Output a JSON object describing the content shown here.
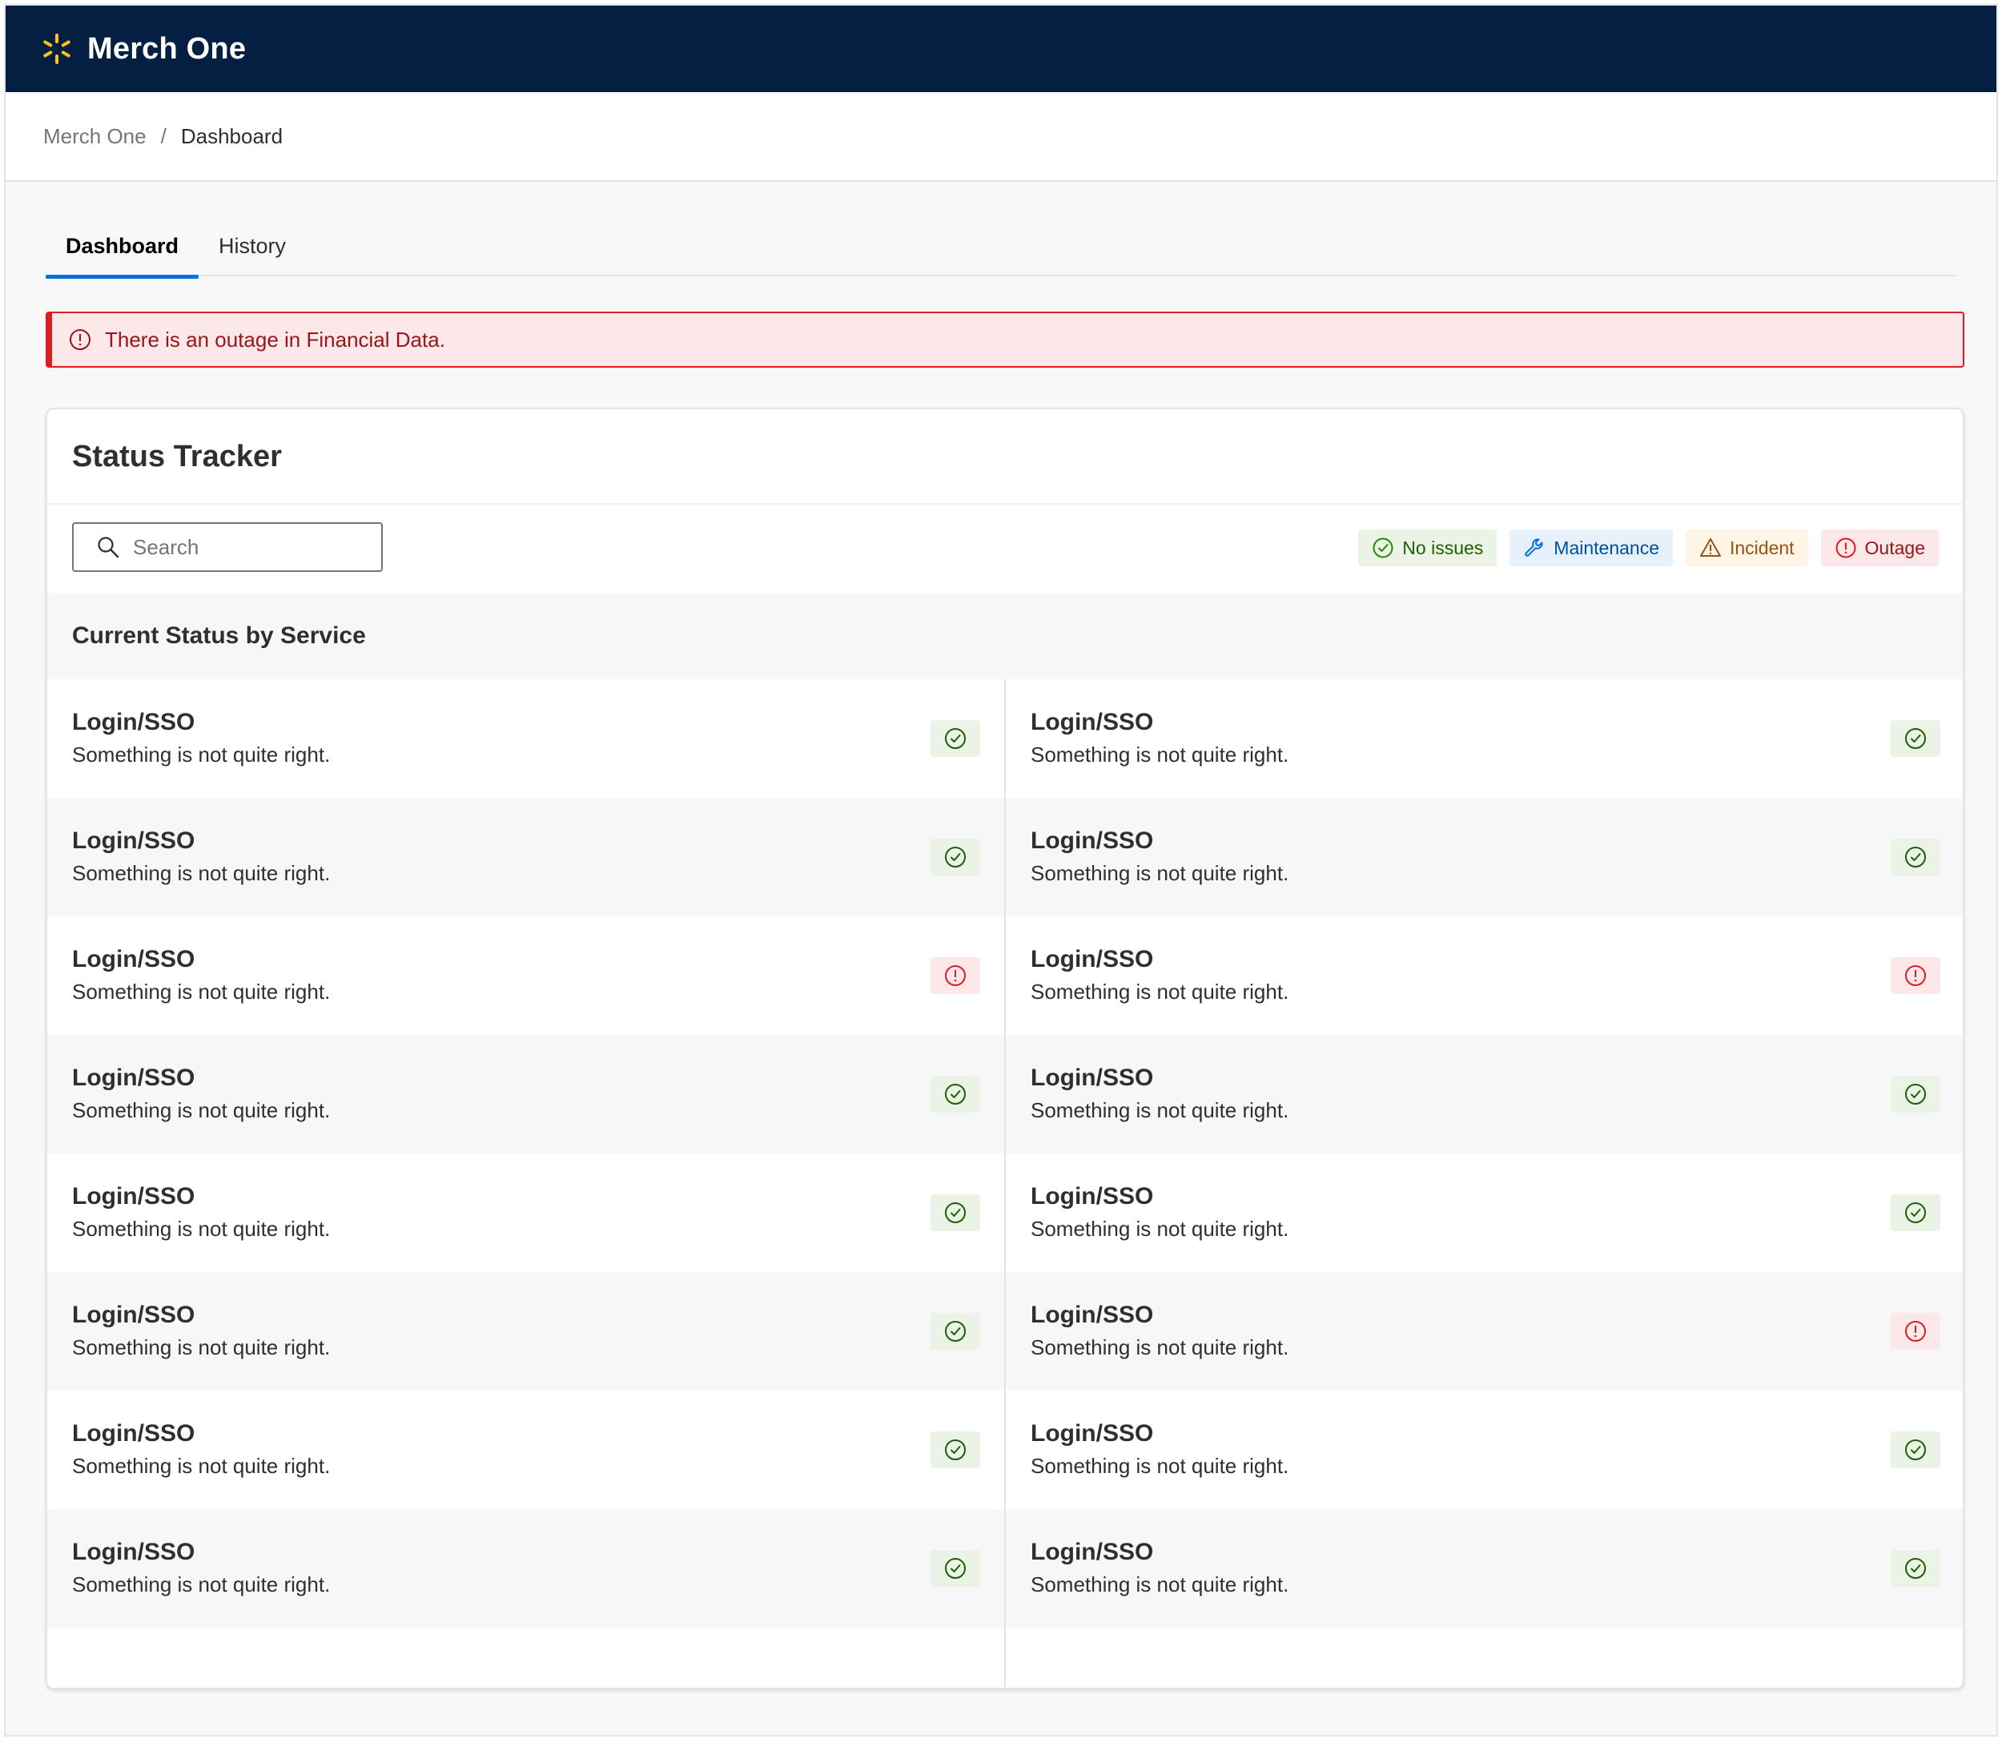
{
  "header": {
    "app_title": "Merch One",
    "logo_icon": "spark-icon",
    "bg_color": "#041f41",
    "logo_color": "#ffc220"
  },
  "breadcrumb": {
    "root": "Merch One",
    "separator": "/",
    "current": "Dashboard"
  },
  "tabs": [
    {
      "label": "Dashboard",
      "active": true
    },
    {
      "label": "History",
      "active": false
    }
  ],
  "alert": {
    "message": "There is an outage in Financial Data.",
    "icon": "alert-circle-icon",
    "color": "#de1c24"
  },
  "status_tracker": {
    "title": "Status Tracker",
    "search": {
      "placeholder": "Search",
      "value": ""
    },
    "legend": [
      {
        "label": "No issues",
        "icon": "check-circle-icon",
        "status": "ok"
      },
      {
        "label": "Maintenance",
        "icon": "wrench-icon",
        "status": "maintenance"
      },
      {
        "label": "Incident",
        "icon": "warning-triangle-icon",
        "status": "incident"
      },
      {
        "label": "Outage",
        "icon": "alert-circle-icon",
        "status": "outage"
      }
    ],
    "section_title": "Current Status by Service",
    "left_services": [
      {
        "name": "Login/SSO",
        "description": "Something is not quite right.",
        "status": "ok"
      },
      {
        "name": "Login/SSO",
        "description": "Something is not quite right.",
        "status": "ok"
      },
      {
        "name": "Login/SSO",
        "description": "Something is not quite right.",
        "status": "outage"
      },
      {
        "name": "Login/SSO",
        "description": "Something is not quite right.",
        "status": "ok"
      },
      {
        "name": "Login/SSO",
        "description": "Something is not quite right.",
        "status": "ok"
      },
      {
        "name": "Login/SSO",
        "description": "Something is not quite right.",
        "status": "ok"
      },
      {
        "name": "Login/SSO",
        "description": "Something is not quite right.",
        "status": "ok"
      },
      {
        "name": "Login/SSO",
        "description": "Something is not quite right.",
        "status": "ok"
      }
    ],
    "right_services": [
      {
        "name": "Login/SSO",
        "description": "Something is not quite right.",
        "status": "ok"
      },
      {
        "name": "Login/SSO",
        "description": "Something is not quite right.",
        "status": "ok"
      },
      {
        "name": "Login/SSO",
        "description": "Something is not quite right.",
        "status": "outage"
      },
      {
        "name": "Login/SSO",
        "description": "Something is not quite right.",
        "status": "ok"
      },
      {
        "name": "Login/SSO",
        "description": "Something is not quite right.",
        "status": "ok"
      },
      {
        "name": "Login/SSO",
        "description": "Something is not quite right.",
        "status": "outage"
      },
      {
        "name": "Login/SSO",
        "description": "Something is not quite right.",
        "status": "ok"
      },
      {
        "name": "Login/SSO",
        "description": "Something is not quite right.",
        "status": "ok"
      }
    ]
  },
  "colors": {
    "ok": "#2a8703",
    "outage": "#de1c24",
    "maintenance": "#0071dc",
    "incident": "#995213",
    "tab_accent": "#0071dc"
  }
}
